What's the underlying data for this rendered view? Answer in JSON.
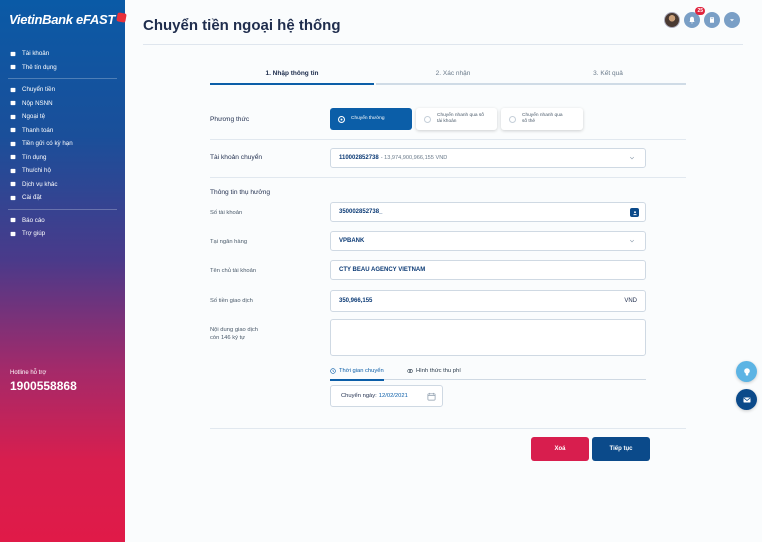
{
  "brand": {
    "name": "VietinBank eFAST"
  },
  "sidebar": {
    "groups": [
      [
        {
          "label": "Tài khoản",
          "icon": "wallet-icon"
        },
        {
          "label": "Thẻ tín dụng",
          "icon": "card-icon"
        }
      ],
      [
        {
          "label": "Chuyển tiền",
          "icon": "transfer-icon"
        },
        {
          "label": "Nộp NSNN",
          "icon": "bank-icon"
        },
        {
          "label": "Ngoại tệ",
          "icon": "exchange-icon"
        },
        {
          "label": "Thanh toán",
          "icon": "payment-icon"
        },
        {
          "label": "Tiền gửi có kỳ hạn",
          "icon": "deposit-icon"
        },
        {
          "label": "Tín dụng",
          "icon": "credit-icon"
        },
        {
          "label": "Thu/chi hộ",
          "icon": "collect-icon"
        },
        {
          "label": "Dịch vụ khác",
          "icon": "services-icon"
        },
        {
          "label": "Cài đặt",
          "icon": "gear-icon"
        }
      ],
      [
        {
          "label": "Báo cáo",
          "icon": "report-icon"
        },
        {
          "label": "Trợ giúp",
          "icon": "help-icon"
        }
      ]
    ],
    "hotline_label": "Hotline hỗ trợ",
    "hotline_number": "1900558868"
  },
  "header": {
    "title": "Chuyển tiền ngoại hệ thống",
    "notification_count": "25"
  },
  "steps": [
    {
      "label": "1. Nhập thông tin",
      "active": true
    },
    {
      "label": "2. Xác nhận",
      "active": false
    },
    {
      "label": "3. Kết quả",
      "active": false
    }
  ],
  "form": {
    "method_label": "Phương thức",
    "methods": [
      {
        "label": "Chuyển thường",
        "selected": true
      },
      {
        "label": "Chuyển nhanh qua số tài khoản",
        "selected": false
      },
      {
        "label": "Chuyển nhanh qua số thẻ",
        "selected": false
      }
    ],
    "source_account_label": "Tài khoản chuyển",
    "source_account_number": "110002852738",
    "source_account_balance": "- 13,974,900,966,155 VND",
    "beneficiary_section": "Thông tin thụ hưởng",
    "account_no_label": "Số tài khoản",
    "account_no_value": "350002852738_",
    "bank_label": "Tại ngân hàng",
    "bank_value": "VPBANK",
    "holder_label": "Tên chủ tài khoản",
    "holder_value": "CTY BEAU AGENCY VIETNAM",
    "amount_label": "Số tiền giao dịch",
    "amount_value": "350,966,155",
    "amount_currency": "VND",
    "content_label": "Nội dung giao dịch",
    "content_hint": "còn 146 ký tự",
    "tab_time": "Thời gian chuyển",
    "tab_fee": "Hình thức thu phí",
    "date_label": "Chuyển ngày:",
    "date_value": "12/02/2021"
  },
  "buttons": {
    "delete": "Xoá",
    "next": "Tiếp tục"
  },
  "colors": {
    "primary": "#0b5ea8",
    "danger": "#d81e4e",
    "navy": "#0b4a8a"
  }
}
